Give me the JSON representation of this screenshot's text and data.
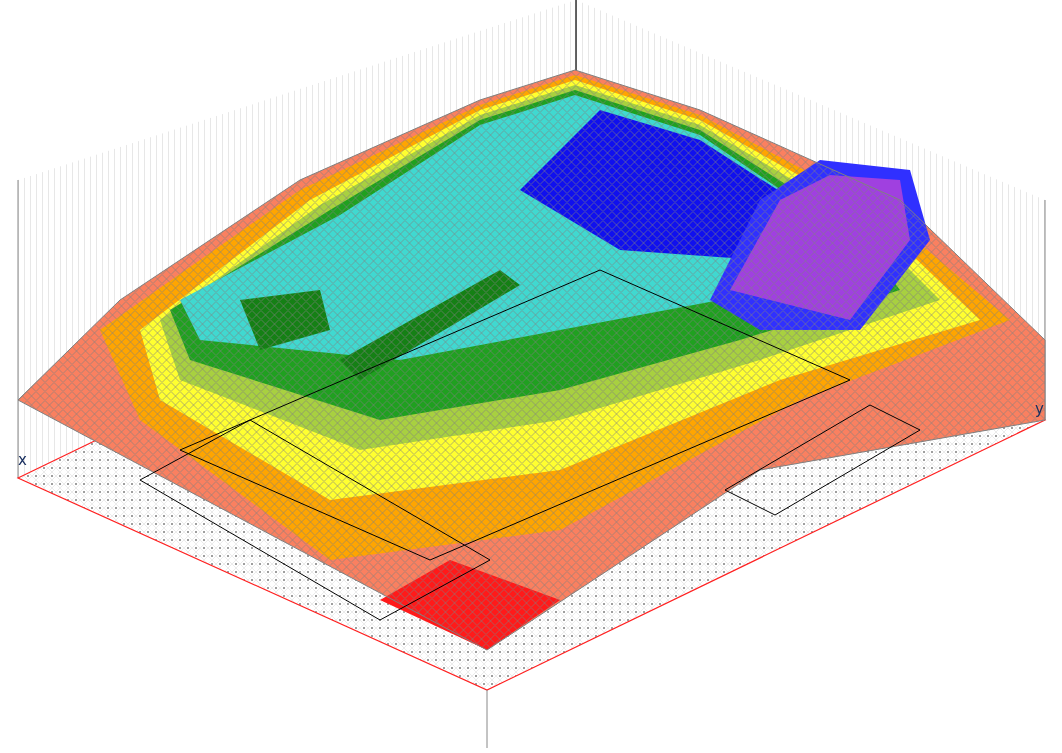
{
  "plot": {
    "x_axis_label": "x",
    "y_axis_label": "y"
  }
}
